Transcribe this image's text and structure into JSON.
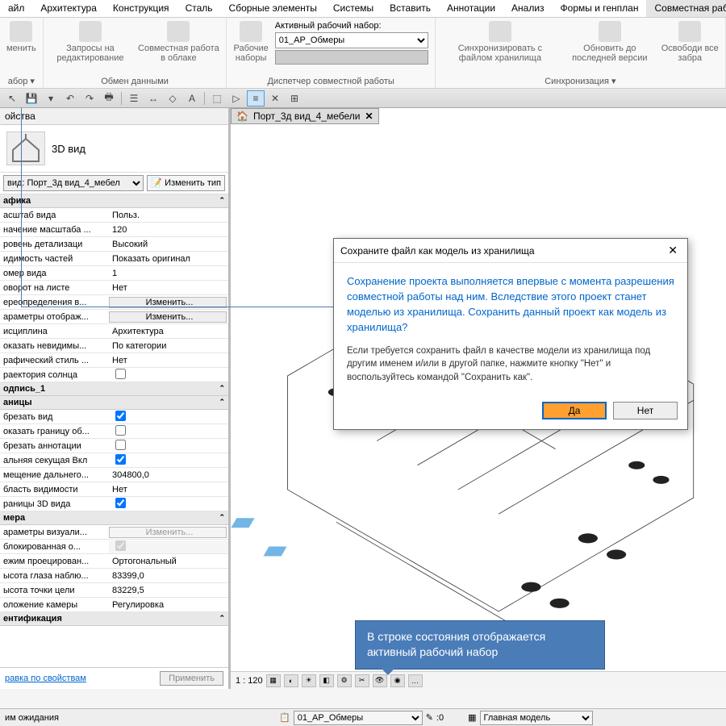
{
  "menu": {
    "items": [
      "айл",
      "Архитектура",
      "Конструкция",
      "Сталь",
      "Сборные элементы",
      "Системы",
      "Вставить",
      "Аннотации",
      "Анализ",
      "Формы и генплан",
      "Совместная работа"
    ],
    "activeIndex": 10
  },
  "ribbon": {
    "groups": [
      {
        "label": "абор ▾",
        "buttons": [
          {
            "label": "менить"
          }
        ]
      },
      {
        "label": "Обмен данными",
        "buttons": [
          {
            "label": "Запросы на\nредактирование"
          },
          {
            "label": "Совместная работа в\nоблаке"
          }
        ]
      },
      {
        "label": "Диспетчер совместной работы",
        "buttons": [
          {
            "label": "Рабочие наборы"
          }
        ],
        "workset": {
          "caption": "Активный рабочий набор:",
          "value": "01_АР_Обмеры"
        }
      },
      {
        "label": "Синхронизация ▾",
        "buttons": [
          {
            "label": "Синхронизировать\nс файлом хранилища"
          },
          {
            "label": "Обновить\nдо последней версии"
          },
          {
            "label": "Освободи\nвсе забра"
          }
        ]
      }
    ]
  },
  "props": {
    "panelTitle": "ойства",
    "typeTitle": "3D вид",
    "selectorLabel": "вид: Порт_3д вид_4_мебел",
    "editType": "Изменить тип",
    "helpLink": "равка по свойствам",
    "applyBtn": "Применить",
    "sections": [
      {
        "title": "афика",
        "rows": [
          {
            "k": "асштаб вида",
            "v": "Польз."
          },
          {
            "k": "начение масштаба ...",
            "v": "120"
          },
          {
            "k": "ровень детализаци",
            "v": "Высокий"
          },
          {
            "k": "идимость частей",
            "v": "Показать оригинал"
          },
          {
            "k": "омер вида",
            "v": "1"
          },
          {
            "k": "оворот на листе",
            "v": "Нет"
          },
          {
            "k": "ереопределения в...",
            "v": "Изменить...",
            "btn": true
          },
          {
            "k": "араметры отображ...",
            "v": "Изменить...",
            "btn": true
          },
          {
            "k": "исциплина",
            "v": "Архитектура"
          },
          {
            "k": "оказать невидимы...",
            "v": "По категории"
          },
          {
            "k": "рафический стиль ...",
            "v": "Нет"
          },
          {
            "k": "раектория солнца",
            "v": "",
            "cb": false
          }
        ]
      },
      {
        "title": "одпись_1",
        "rows": []
      },
      {
        "title": "аницы",
        "rows": [
          {
            "k": "брезать вид",
            "v": "",
            "cb": true
          },
          {
            "k": "оказать границу об...",
            "v": "",
            "cb": false
          },
          {
            "k": "брезать аннотации",
            "v": "",
            "cb": false
          },
          {
            "k": "альняя секущая Вкл",
            "v": "",
            "cb": true
          },
          {
            "k": "мещение дальнего...",
            "v": "304800,0"
          },
          {
            "k": "бласть видимости",
            "v": "Нет"
          },
          {
            "k": "раницы 3D вида",
            "v": "",
            "cb": true
          }
        ]
      },
      {
        "title": "мера",
        "rows": [
          {
            "k": "араметры визуали...",
            "v": "Изменить...",
            "btn": true,
            "grey": true
          },
          {
            "k": "блокированная о...",
            "v": "",
            "cb": true,
            "grey": true
          },
          {
            "k": "ежим проецирован...",
            "v": "Ортогональный"
          },
          {
            "k": "ысота глаза наблю...",
            "v": "83399,0"
          },
          {
            "k": "ысота точки цели",
            "v": "83229,5"
          },
          {
            "k": "оложение камеры",
            "v": "Регулировка"
          }
        ]
      },
      {
        "title": "ентификация",
        "rows": []
      }
    ]
  },
  "viewport": {
    "tabTitle": "Порт_3д вид_4_мебели",
    "scaleText": "1 : 120"
  },
  "dialog": {
    "title": "Сохраните файл как модель из хранилища",
    "main": "Сохранение проекта выполняется впервые с момента разрешения совместной работы над ним. Вследствие этого проект станет моделью из хранилища. Сохранить данный проект как модель из хранилища?",
    "sub": "Если требуется сохранить файл в качестве модели из хранилища под другим именем и/или в другой папке, нажмите кнопку \"Нет\" и воспользуйтесь командой \"Сохранить как\".",
    "yes": "Да",
    "no": "Нет"
  },
  "callout": {
    "text": "В строке состояния отображается активный рабочий набор"
  },
  "status": {
    "left": "им ожидания",
    "wsValue": "01_АР_Обмеры",
    "zero": ":0",
    "model": "Главная модель"
  }
}
